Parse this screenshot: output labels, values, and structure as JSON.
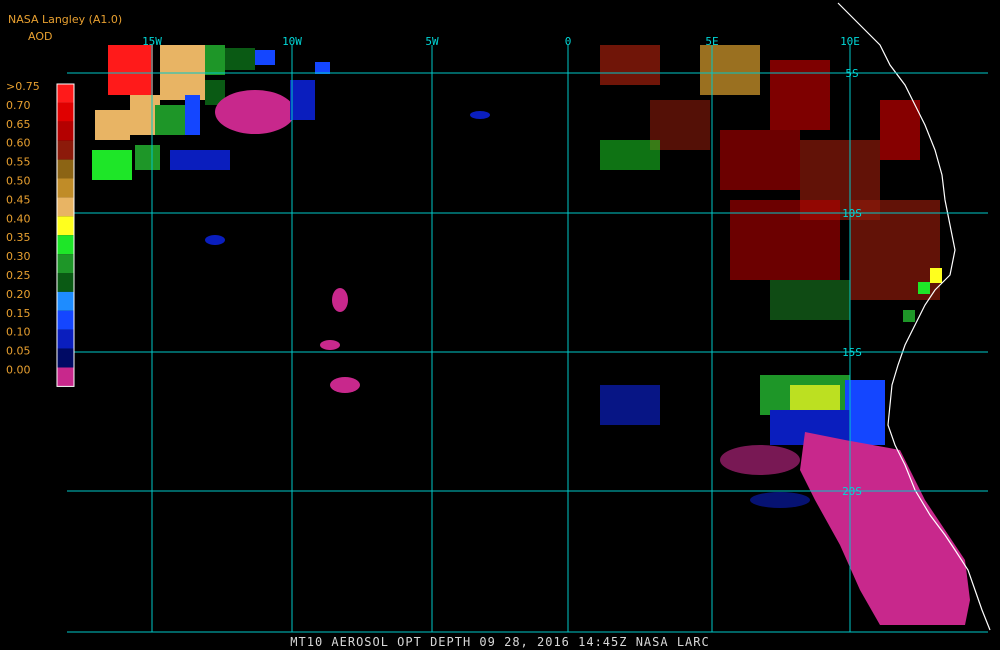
{
  "header": {
    "source": "NASA Langley (A1.0)",
    "product": "AOD"
  },
  "legend": {
    "levels": [
      {
        "label": ">0.75",
        "color": "#ff1a1a"
      },
      {
        "label": "0.70",
        "color": "#e00000"
      },
      {
        "label": "0.65",
        "color": "#b40000"
      },
      {
        "label": "0.60",
        "color": "#8c1a0a"
      },
      {
        "label": "0.55",
        "color": "#8c6414"
      },
      {
        "label": "0.50",
        "color": "#c08c28"
      },
      {
        "label": "0.45",
        "color": "#e8b464"
      },
      {
        "label": "0.40",
        "color": "#ffff1e"
      },
      {
        "label": "0.35",
        "color": "#1ee628"
      },
      {
        "label": "0.30",
        "color": "#1e9628"
      },
      {
        "label": "0.25",
        "color": "#0a5a14"
      },
      {
        "label": "0.20",
        "color": "#1e8cff"
      },
      {
        "label": "0.15",
        "color": "#1446ff"
      },
      {
        "label": "0.10",
        "color": "#0a1ebe"
      },
      {
        "label": "0.05",
        "color": "#000a64"
      },
      {
        "label": "0.00",
        "color": "#c8288c"
      }
    ]
  },
  "grid": {
    "color": "#00c8c8",
    "longitudes": [
      "15W",
      "10W",
      "5W",
      "0",
      "5E",
      "10E"
    ],
    "latitudes": [
      "5S",
      "10S",
      "15S",
      "20S"
    ]
  },
  "footer": {
    "text": "MT10  AEROSOL OPT DEPTH   09 28, 2016 14:45Z   NASA LARC"
  }
}
